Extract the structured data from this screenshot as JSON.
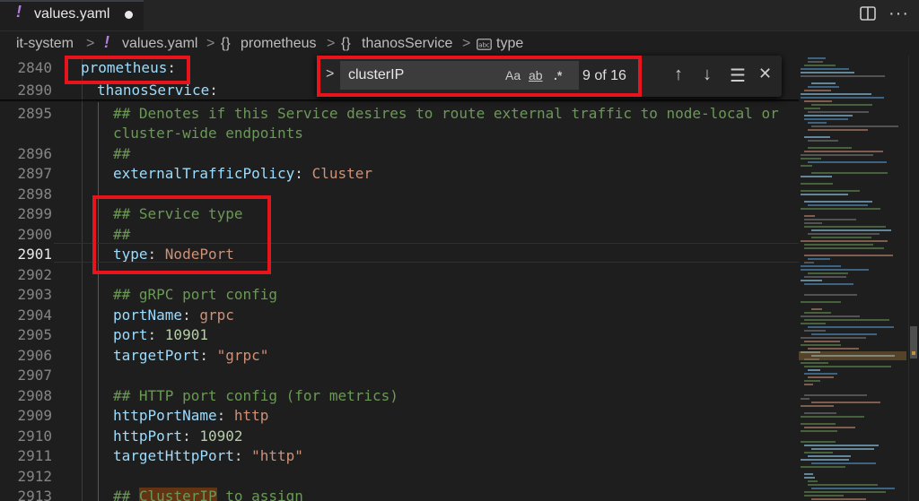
{
  "tab": {
    "title": "values.yaml",
    "file_icon": "!",
    "dirty": true
  },
  "actions": {
    "split_icon": "split-editor-icon",
    "more_label": "···"
  },
  "breadcrumb": {
    "folder": "it-system",
    "file": "values.yaml",
    "items": [
      "prometheus",
      "thanosService",
      "type"
    ],
    "obj_icon": "{}",
    "sep": ">"
  },
  "find": {
    "toggle": ">",
    "value": "clusterIP",
    "match_case": "Aa",
    "whole_word": "ab",
    "regex": ".*",
    "count": "9 of 16",
    "prev": "↑",
    "next": "↓",
    "in_selection": "☰",
    "close": "✕"
  },
  "sticky": [
    {
      "num": "2840",
      "key": "prometheus",
      "colon": ":"
    },
    {
      "num": "2890",
      "key": "thanosService",
      "colon": ":"
    }
  ],
  "lines": {
    "l2895": {
      "num": "2895",
      "a": "## Denotes if this Service desires to route external traffic to node-local or"
    },
    "l2895b": {
      "a": "cluster-wide endpoints"
    },
    "l2896": {
      "num": "2896",
      "a": "##"
    },
    "l2897": {
      "num": "2897",
      "key": "externalTrafficPolicy",
      "colon": ": ",
      "val": "Cluster"
    },
    "l2898": {
      "num": "2898"
    },
    "l2899": {
      "num": "2899",
      "a": "## Service type"
    },
    "l2900": {
      "num": "2900",
      "a": "##"
    },
    "l2901": {
      "num": "2901",
      "key": "type",
      "colon": ": ",
      "val": "NodePort"
    },
    "l2902": {
      "num": "2902"
    },
    "l2903": {
      "num": "2903",
      "a": "## gRPC port config"
    },
    "l2904": {
      "num": "2904",
      "key": "portName",
      "colon": ": ",
      "val": "grpc"
    },
    "l2905": {
      "num": "2905",
      "key": "port",
      "colon": ": ",
      "val": "10901"
    },
    "l2906": {
      "num": "2906",
      "key": "targetPort",
      "colon": ": ",
      "val": "\"grpc\""
    },
    "l2907": {
      "num": "2907"
    },
    "l2908": {
      "num": "2908",
      "a": "## HTTP port config (for metrics)"
    },
    "l2909": {
      "num": "2909",
      "key": "httpPortName",
      "colon": ": ",
      "val": "http"
    },
    "l2910": {
      "num": "2910",
      "key": "httpPort",
      "colon": ": ",
      "val": "10902"
    },
    "l2911": {
      "num": "2911",
      "key": "targetHttpPort",
      "colon": ": ",
      "val": "\"http\""
    },
    "l2912": {
      "num": "2912"
    },
    "l2913": {
      "num": "2913",
      "a": "## ",
      "match": "ClusterIP",
      "b": " to assign"
    }
  },
  "colors": {
    "editor_bg": "#1e1e1e",
    "key": "#569cd6",
    "comment": "#6a9955",
    "string": "#ce9178",
    "number": "#b5cea8",
    "annotation_red": "#e8141b",
    "match_highlight": "#623315"
  }
}
